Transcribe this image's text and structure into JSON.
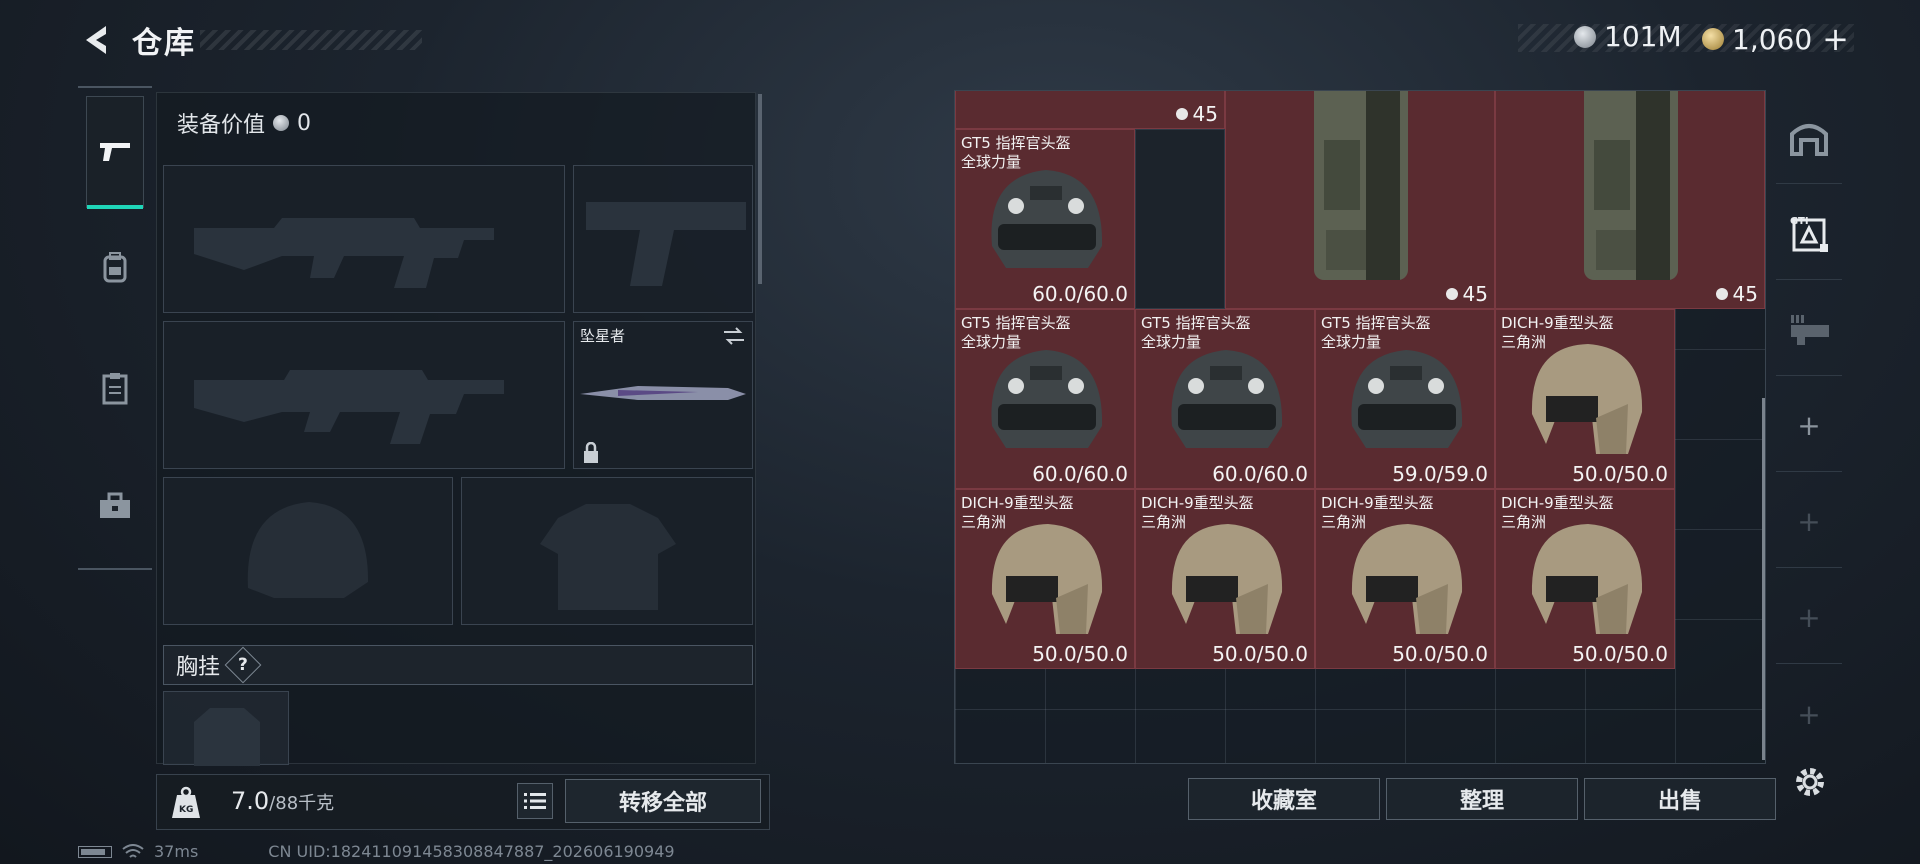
{
  "header": {
    "title": "仓库",
    "currency_silver": "101M",
    "currency_gold": "1,060",
    "add_symbol": "+"
  },
  "loadout": {
    "equip_value_label": "装备价值",
    "equip_value": "0",
    "melee_name": "坠星者",
    "chest_rig_label": "胸挂",
    "chest_rig_help": "?"
  },
  "bottom": {
    "weight_current": "7.0",
    "weight_max": "/88千克",
    "transfer_all": "转移全部"
  },
  "status": {
    "ping": "37ms",
    "uid": "CN UID:182411091458308847887_202606190949"
  },
  "inventory": {
    "top_counts": [
      "45",
      "45",
      "45"
    ],
    "items": [
      {
        "name1": "GT5 指挥官头盔",
        "name2": "全球力量",
        "durability": "60.0/60.0",
        "type": "gt5"
      },
      {
        "name1": "GT5 指挥官头盔",
        "name2": "全球力量",
        "durability": "60.0/60.0",
        "type": "gt5"
      },
      {
        "name1": "GT5 指挥官头盔",
        "name2": "全球力量",
        "durability": "60.0/60.0",
        "type": "gt5"
      },
      {
        "name1": "GT5 指挥官头盔",
        "name2": "全球力量",
        "durability": "59.0/59.0",
        "type": "gt5"
      },
      {
        "name1": "DICH-9重型头盔",
        "name2": "三角洲",
        "durability": "50.0/50.0",
        "type": "dich"
      },
      {
        "name1": "DICH-9重型头盔",
        "name2": "三角洲",
        "durability": "50.0/50.0",
        "type": "dich"
      },
      {
        "name1": "DICH-9重型头盔",
        "name2": "三角洲",
        "durability": "50.0/50.0",
        "type": "dich"
      },
      {
        "name1": "DICH-9重型头盔",
        "name2": "三角洲",
        "durability": "50.0/50.0",
        "type": "dich"
      },
      {
        "name1": "DICH-9重型头盔",
        "name2": "三角洲",
        "durability": "50.0/50.0",
        "type": "dich"
      }
    ]
  },
  "actions": {
    "collection": "收藏室",
    "organize": "整理",
    "sell": "出售"
  },
  "colors": {
    "accent": "#1fd6b8",
    "item_bg": "#5a2b30"
  }
}
